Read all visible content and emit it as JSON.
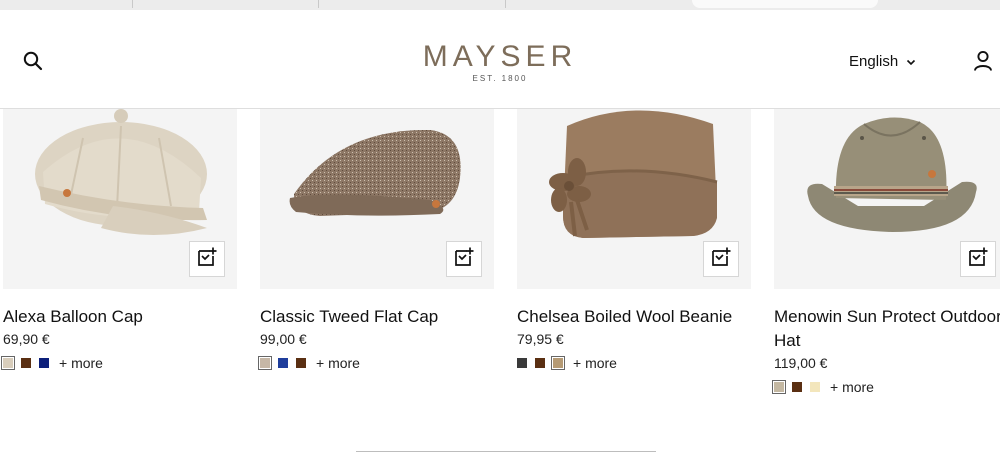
{
  "header": {
    "brand": "MAYSER",
    "brand_sub": "EST. 1800",
    "language": "English"
  },
  "products": [
    {
      "name": "Alexa Balloon Cap",
      "price": "69,90 €",
      "swatches": [
        "#d8cdbb",
        "#5a2f12",
        "#0c1f7a"
      ],
      "more": "+ more"
    },
    {
      "name": "Classic Tweed Flat Cap",
      "price": "99,00 €",
      "swatches": [
        "#c6b7a6",
        "#1f3e9c",
        "#5a2f12"
      ],
      "more": "+ more"
    },
    {
      "name": "Chelsea Boiled Wool Beanie",
      "price": "79,95 €",
      "swatches": [
        "#3a3a3a",
        "#5a2f12",
        "#b59a74"
      ],
      "more": "+ more"
    },
    {
      "name": "Menowin Sun Protect Outdoor Hat",
      "price": "119,00 €",
      "swatches": [
        "#c4b8a2",
        "#5a2f12",
        "#f3e6bc"
      ],
      "more": "+ more"
    }
  ],
  "icons": {
    "search": "search-icon",
    "account": "user-icon",
    "chevron": "chevron-down-icon",
    "quick_add": "add-to-cart-icon"
  }
}
